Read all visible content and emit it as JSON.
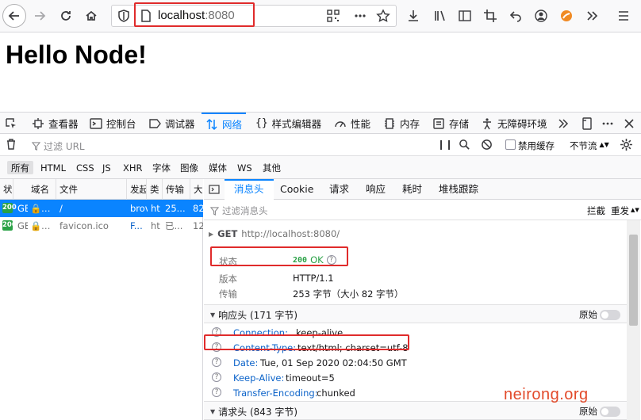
{
  "browser": {
    "url_host": "localhost",
    "url_port": ":8080"
  },
  "page": {
    "heading": "Hello Node!"
  },
  "devtools": {
    "tools": [
      {
        "label": "查看器"
      },
      {
        "label": "控制台"
      },
      {
        "label": "调试器"
      },
      {
        "label": "网络"
      },
      {
        "label": "样式编辑器"
      },
      {
        "label": "性能"
      },
      {
        "label": "内存"
      },
      {
        "label": "存储"
      },
      {
        "label": "无障碍环境"
      }
    ],
    "filter_placeholder": "过滤 URL",
    "disable_cache_label": "禁用缓存",
    "throttle_label": "不节流",
    "types": [
      "所有",
      "HTML",
      "CSS",
      "JS",
      "XHR",
      "字体",
      "图像",
      "媒体",
      "WS",
      "其他"
    ],
    "columns": [
      "状",
      "域名",
      "文件",
      "发起",
      "类",
      "传输",
      "大"
    ],
    "requests": [
      {
        "status": "200",
        "method": "GE",
        "domain": "…",
        "file": "/",
        "initiator": "brov",
        "type": "ht",
        "transfer": "25...",
        "size": "82"
      },
      {
        "status": "200",
        "method": "GE",
        "domain": "…",
        "file": "favicon.ico",
        "initiator": "F...",
        "type": "ht",
        "transfer": "已...",
        "size": "12"
      }
    ],
    "detail_tabs": [
      "消息头",
      "Cookie",
      "请求",
      "响应",
      "耗时",
      "堆栈跟踪"
    ],
    "header_filter_placeholder": "过滤消息头",
    "block_label": "拦截",
    "resend_label": "重发",
    "summary": {
      "method": "GET",
      "url": "http://localhost:8080/",
      "status_label": "状态",
      "status_code": "200",
      "status_text": "OK",
      "version_label": "版本",
      "version": "HTTP/1.1",
      "transfer_label": "传输",
      "transfer": "253 字节（大小 82 字节）"
    },
    "response_headers_title": "响应头 (171 字节)",
    "raw_label": "原始",
    "response_headers": [
      {
        "name": "Connection:",
        "value": "keep-alive"
      },
      {
        "name": "Content-Type:",
        "value": "text/html; charset=utf-8"
      },
      {
        "name": "Date:",
        "value": "Tue, 01 Sep 2020 02:04:50 GMT"
      },
      {
        "name": "Keep-Alive:",
        "value": "timeout=5"
      },
      {
        "name": "Transfer-Encoding:",
        "value": "chunked"
      }
    ],
    "request_headers_title": "请求头 (843 字节)"
  },
  "watermark": "neirong.org",
  "colors": {
    "accent": "#0a84ff",
    "status_ok": "#2aa146",
    "highlight": "#e02b2b"
  }
}
